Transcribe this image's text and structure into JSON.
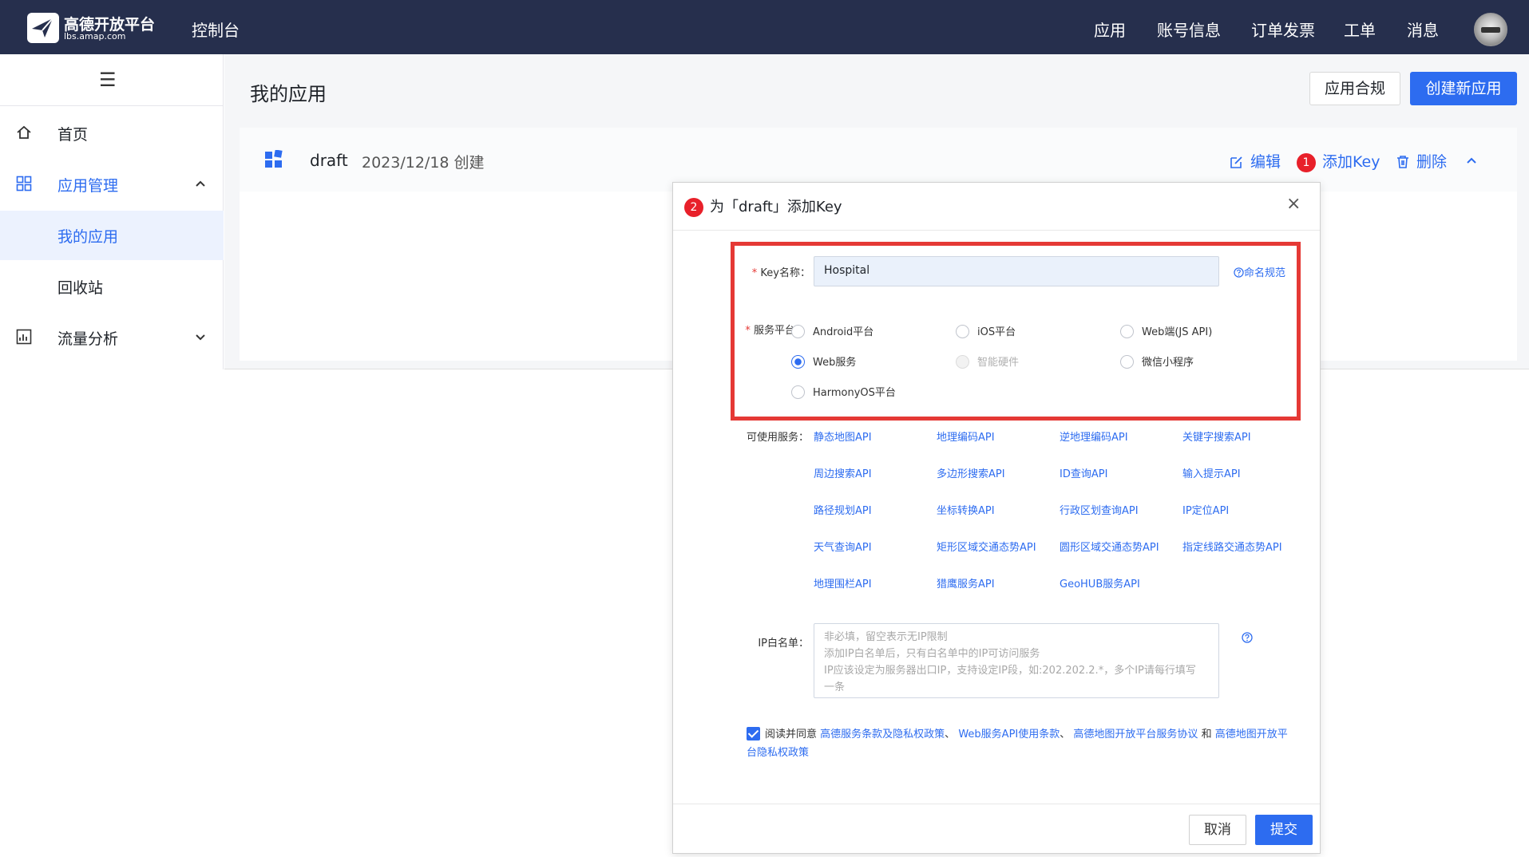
{
  "header": {
    "logo_title": "高德开放平台",
    "logo_subtitle": "lbs.amap.com",
    "console": "控制台",
    "nav": [
      "应用",
      "账号信息",
      "订单发票",
      "工单",
      "消息"
    ]
  },
  "sidebar": {
    "menu_icon": "☰",
    "items": [
      {
        "label": "首页",
        "icon": "home-icon"
      },
      {
        "label": "应用管理",
        "icon": "grid-icon"
      },
      {
        "label": "我的应用"
      },
      {
        "label": "回收站"
      },
      {
        "label": "流量分析",
        "icon": "chart-icon"
      }
    ]
  },
  "main": {
    "title": "我的应用",
    "compliance_button": "应用合规",
    "create_button": "创建新应用",
    "app": {
      "name": "draft",
      "created": "2023/12/18 创建",
      "actions": {
        "edit": "编辑",
        "add_key": "添加Key",
        "delete": "删除"
      },
      "step1": "1"
    }
  },
  "modal": {
    "step2": "2",
    "title": "为「draft」添加Key",
    "close": "×",
    "key_label": "Key名称：",
    "key_value": "Hospital",
    "naming_link": "命名规范",
    "platform_label": "服务平台：",
    "platforms": [
      {
        "label": "Android平台"
      },
      {
        "label": "iOS平台"
      },
      {
        "label": "Web端(JS API)"
      },
      {
        "label": "Web服务",
        "selected": true
      },
      {
        "label": "智能硬件",
        "disabled": true
      },
      {
        "label": "微信小程序"
      },
      {
        "label": "HarmonyOS平台"
      }
    ],
    "services_label": "可使用服务：",
    "services": [
      "静态地图API",
      "地理编码API",
      "逆地理编码API",
      "关键字搜索API",
      "周边搜索API",
      "多边形搜索API",
      "ID查询API",
      "输入提示API",
      "路径规划API",
      "坐标转换API",
      "行政区划查询API",
      "IP定位API",
      "天气查询API",
      "矩形区域交通态势API",
      "圆形区域交通态势API",
      "指定线路交通态势API",
      "地理围栏API",
      "猎鹰服务API",
      "GeoHUB服务API"
    ],
    "ip_label": "IP白名单：",
    "ip_placeholder_lines": [
      "非必填，留空表示无IP限制",
      "添加IP白名单后，只有白名单中的IP可访问服务",
      "IP应该设定为服务器出口IP，支持设定IP段，如:202.202.2.*，多个IP请每行填写",
      "一条"
    ],
    "agree": {
      "prefix": "阅读并同意",
      "link1": "高德服务条款及隐私权政策",
      "sep1": "、",
      "link2": "Web服务API使用条款",
      "sep2": "、",
      "link3": "高德地图开放平台服务协议",
      "and": "和",
      "link4": "高德地图开放平台隐私权政策"
    },
    "cancel": "取消",
    "submit": "提交"
  },
  "colors": {
    "header_bg": "#262f4d",
    "primary": "#2d6cf0",
    "highlight": "#e53935"
  }
}
